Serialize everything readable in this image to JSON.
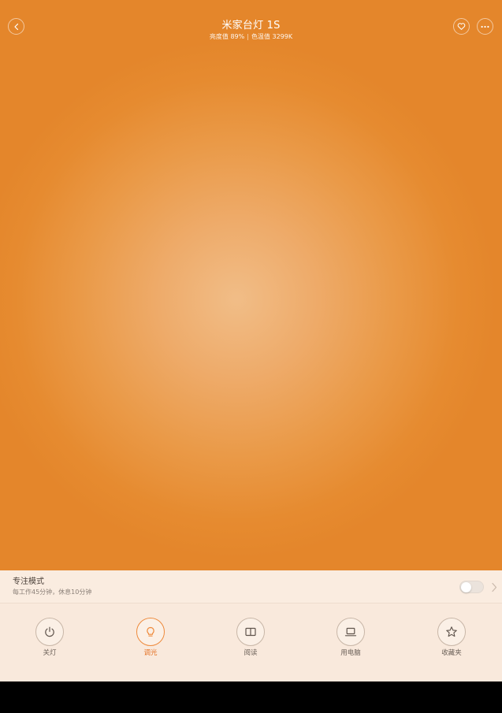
{
  "header": {
    "title": "米家台灯 1S",
    "brightness_text": "亮度值 89%",
    "separator": "|",
    "color_temp_text": "色温值 3299K",
    "back_icon": "chevron-left-icon",
    "favorite_icon": "heart-icon",
    "more_icon": "more-dots-icon"
  },
  "focus_mode": {
    "title": "专注模式",
    "description": "每工作45分钟，休息10分钟",
    "enabled": false
  },
  "modes": [
    {
      "label": "关灯",
      "icon": "power-icon",
      "active": false
    },
    {
      "label": "调光",
      "icon": "bulb-icon",
      "active": true
    },
    {
      "label": "阅读",
      "icon": "book-icon",
      "active": false
    },
    {
      "label": "用电脑",
      "icon": "laptop-icon",
      "active": false
    },
    {
      "label": "收藏夹",
      "icon": "star-icon",
      "active": false
    }
  ],
  "colors": {
    "light_center": "#f1bd87",
    "light_edge": "#e4862b",
    "accent": "#ee8a3c",
    "panel_bg": "#f9e9dc"
  }
}
